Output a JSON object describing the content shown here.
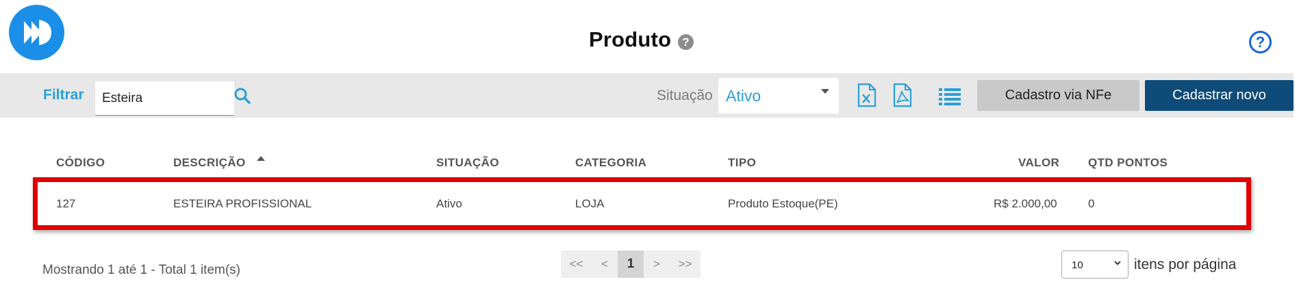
{
  "header": {
    "title": "Produto",
    "title_help": "?",
    "help": "?"
  },
  "filter": {
    "label": "Filtrar",
    "value": "Esteira",
    "situacao_label": "Situação",
    "situacao_value": "Ativo"
  },
  "toolbar": {
    "icons": [
      "excel-icon",
      "pdf-icon",
      "list-icon"
    ],
    "nfe_label": "Cadastro via NFe",
    "new_label": "Cadastrar novo"
  },
  "table": {
    "columns": [
      "CÓDIGO",
      "DESCRIÇÃO",
      "SITUAÇÃO",
      "CATEGORIA",
      "TIPO",
      "VALOR",
      "QTD PONTOS"
    ],
    "sorted_column": "DESCRIÇÃO",
    "rows": [
      [
        "127",
        "ESTEIRA PROFISSIONAL",
        "Ativo",
        "LOJA",
        "Produto Estoque(PE)",
        "R$ 2.000,00",
        "0"
      ]
    ]
  },
  "footer": {
    "showing": "Mostrando 1 até 1 - Total 1 item(s)",
    "pager": [
      "<<",
      "<",
      "1",
      ">",
      ">>"
    ],
    "current_page": "1",
    "page_size": "10",
    "per_page_label": "itens por página"
  },
  "colors": {
    "accent": "#2a9fd8",
    "primary_button": "#0e4b78",
    "highlight": "#e00000",
    "logo": "#1b8fe8"
  }
}
